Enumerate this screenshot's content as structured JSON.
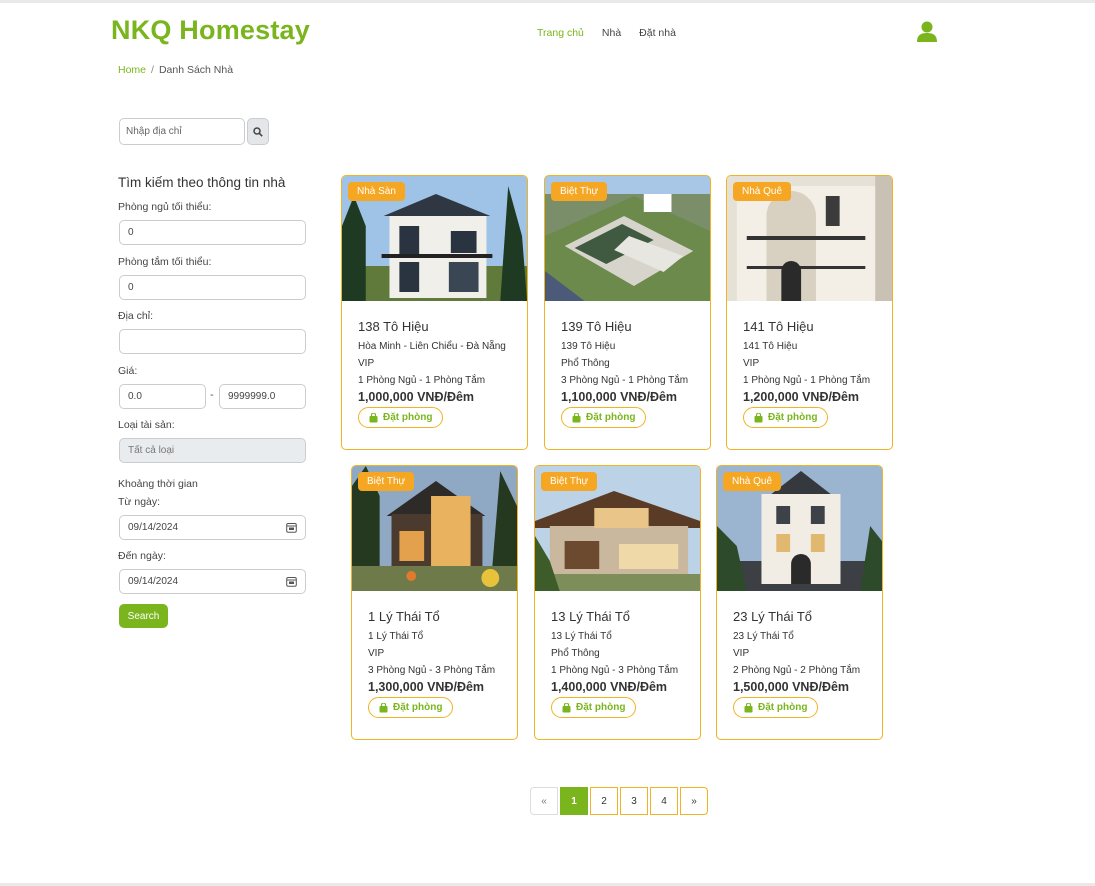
{
  "header": {
    "brand": "NKQ Homestay",
    "nav": [
      "Trang chủ",
      "Nhà",
      "Đặt nhà"
    ],
    "active_nav": "Trang chủ"
  },
  "breadcrumb": {
    "home": "Home",
    "separator": "/",
    "current": "Danh Sách Nhà"
  },
  "address_search": {
    "placeholder": "Nhập địa chỉ"
  },
  "filter": {
    "title": "Tìm kiếm theo thông tin nhà",
    "bedrooms_label": "Phòng ngủ tối thiểu:",
    "bedrooms_value": "0",
    "bathrooms_label": "Phòng tắm tối thiểu:",
    "bathrooms_value": "0",
    "address_label": "Địa chỉ:",
    "address_value": "",
    "price_label": "Giá:",
    "price_min": "0.0",
    "price_dash": "-",
    "price_max": "9999999.0",
    "type_label": "Loại tài sản:",
    "type_value": "Tất cả loại",
    "period_label": "Khoảng thời gian",
    "from_label": "Từ ngày:",
    "from_value": "09/14/2024",
    "to_label": "Đến ngày:",
    "to_value": "09/14/2024",
    "search_label": "Search"
  },
  "listings": [
    {
      "badge": "Nhà Sàn",
      "title": "138 Tô Hiệu",
      "address": "Hòa Minh - Liên Chiểu - Đà Nẵng",
      "tier": "VIP",
      "rooms": "1 Phòng Ngủ - 1 Phòng Tắm",
      "price": "1,000,000 VNĐ/Đêm",
      "book": "Đặt phòng"
    },
    {
      "badge": "Biệt Thự",
      "title": "139 Tô Hiệu",
      "address": "139 Tô Hiệu",
      "tier": "Phổ Thông",
      "rooms": "3 Phòng Ngủ - 1 Phòng Tắm",
      "price": "1,100,000 VNĐ/Đêm",
      "book": "Đặt phòng"
    },
    {
      "badge": "Nhà Quê",
      "title": "141 Tô Hiệu",
      "address": "141 Tô Hiệu",
      "tier": "VIP",
      "rooms": "1 Phòng Ngủ - 1 Phòng Tắm",
      "price": "1,200,000 VNĐ/Đêm",
      "book": "Đặt phòng"
    },
    {
      "badge": "Biệt Thự",
      "title": "1 Lý Thái Tổ",
      "address": "1 Lý Thái Tổ",
      "tier": "VIP",
      "rooms": "3 Phòng Ngủ - 3 Phòng Tắm",
      "price": "1,300,000 VNĐ/Đêm",
      "book": "Đặt phòng"
    },
    {
      "badge": "Biệt Thự",
      "title": "13 Lý Thái Tổ",
      "address": "13 Lý Thái Tổ",
      "tier": "Phổ Thông",
      "rooms": "1 Phòng Ngủ - 3 Phòng Tắm",
      "price": "1,400,000 VNĐ/Đêm",
      "book": "Đặt phòng"
    },
    {
      "badge": "Nhà Quê",
      "title": "23 Lý Thái Tổ",
      "address": "23 Lý Thái Tổ",
      "tier": "VIP",
      "rooms": "2 Phòng Ngủ - 2 Phòng Tắm",
      "price": "1,500,000 VNĐ/Đêm",
      "book": "Đặt phòng"
    }
  ],
  "pagination": {
    "prev": "«",
    "pages": [
      "1",
      "2",
      "3",
      "4"
    ],
    "current": "1",
    "next": "»"
  },
  "colors": {
    "brand_green": "#7ab51d",
    "accent_orange": "#f5a623",
    "card_border": "#f0b323"
  },
  "icons": {
    "user": "user-icon",
    "search": "search-icon",
    "calendar": "calendar-icon",
    "bag": "shopping-bag-icon"
  }
}
